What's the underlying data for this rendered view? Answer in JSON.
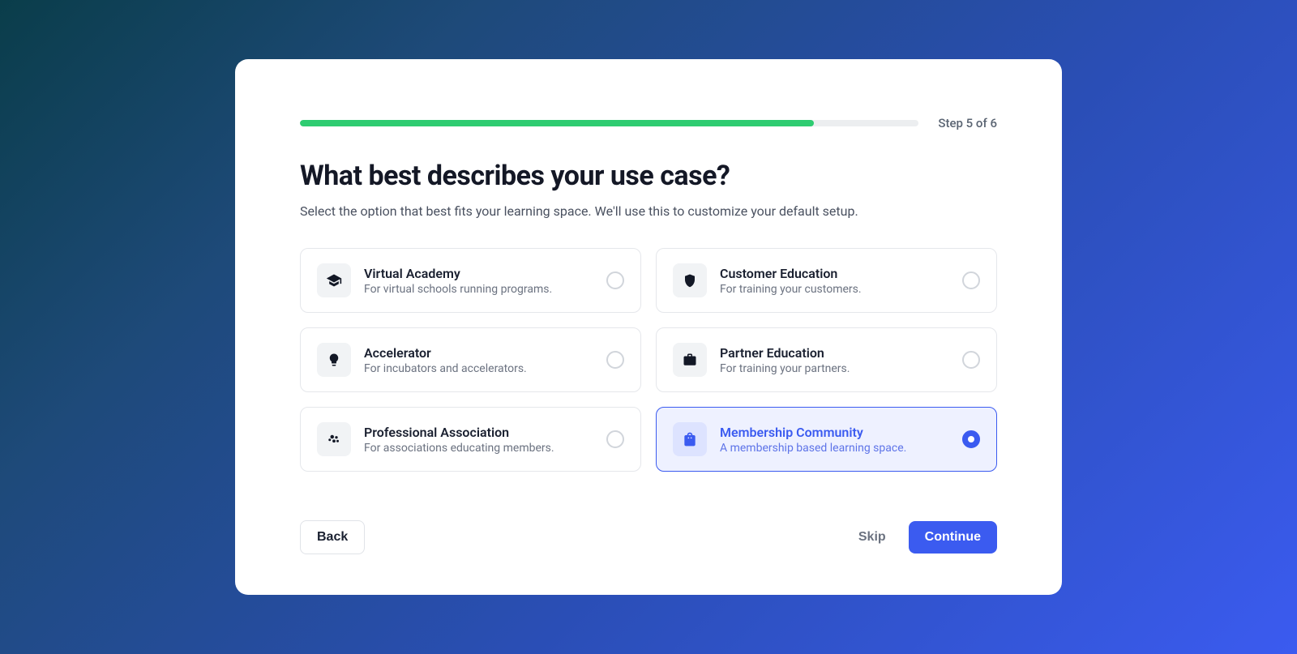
{
  "progress": {
    "percent": 83,
    "step_label": "Step 5 of 6"
  },
  "heading": "What best describes your use case?",
  "subheading": "Select the option that best fits your learning space. We'll use this to customize your default setup.",
  "options": [
    {
      "id": "virtual-academy",
      "icon": "graduation-cap-icon",
      "title": "Virtual Academy",
      "desc": "For virtual schools running programs.",
      "selected": false
    },
    {
      "id": "customer-education",
      "icon": "shield-icon",
      "title": "Customer Education",
      "desc": "For training your customers.",
      "selected": false
    },
    {
      "id": "accelerator",
      "icon": "lightbulb-icon",
      "title": "Accelerator",
      "desc": "For incubators and accelerators.",
      "selected": false
    },
    {
      "id": "partner-education",
      "icon": "briefcase-icon",
      "title": "Partner Education",
      "desc": "For training your partners.",
      "selected": false
    },
    {
      "id": "professional-association",
      "icon": "people-icon",
      "title": "Professional Association",
      "desc": "For associations educating members.",
      "selected": false
    },
    {
      "id": "membership-community",
      "icon": "shopping-bag-icon",
      "title": "Membership Community",
      "desc": "A membership based learning space.",
      "selected": true
    }
  ],
  "footer": {
    "back": "Back",
    "skip": "Skip",
    "continue": "Continue"
  },
  "colors": {
    "accent": "#3b5bf0",
    "progress": "#2ecc71"
  }
}
